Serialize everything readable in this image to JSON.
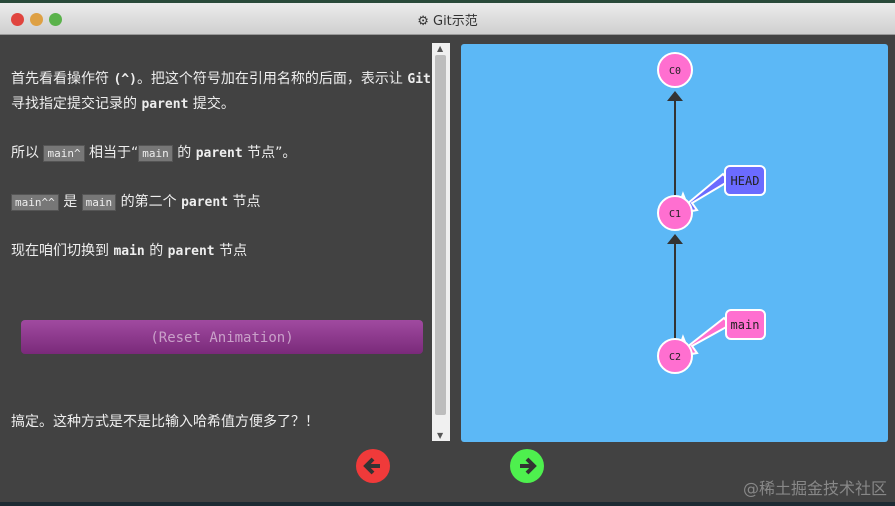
{
  "window": {
    "title": "Git示范"
  },
  "lesson": {
    "p1a": "首先看看操作符 ",
    "p1b": "(^)",
    "p1c": "。把这个符号加在引用名称的后面，表示让 ",
    "p1d": "Git",
    "p1e": " 寻找指定提交记录的 ",
    "p1f": "parent",
    "p1g": " 提交。",
    "p2a": "所以 ",
    "p2b": "main^",
    "p2c": " 相当于“",
    "p2d": "main",
    "p2e": " 的 ",
    "p2f": "parent",
    "p2g": " 节点”。",
    "p3a": "main^^",
    "p3b": " 是 ",
    "p3c": "main",
    "p3d": " 的第二个 ",
    "p3e": "parent",
    "p3f": " 节点",
    "p4a": "现在咱们切换到 ",
    "p4b": "main",
    "p4c": " 的 ",
    "p4d": "parent",
    "p4e": " 节点",
    "reset": "(Reset Animation)",
    "final": "搞定。这种方式是不是比输入哈希值方便多了？！"
  },
  "graph": {
    "commits": [
      "C0",
      "C1",
      "C2"
    ],
    "head": "HEAD",
    "branch": "main",
    "colors": {
      "commit": "#ff6fd0",
      "head": "#6b6bff",
      "branch": "#ff6fd0",
      "canvas": "#5cb8f6"
    }
  },
  "watermark": "@稀土掘金技术社区"
}
